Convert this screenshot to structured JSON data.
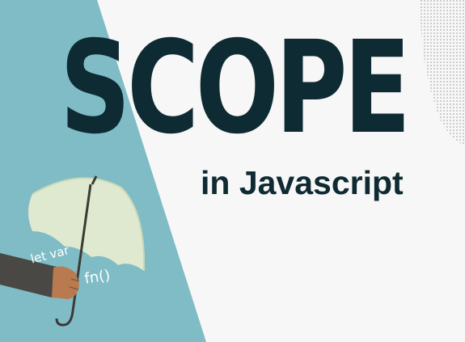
{
  "title": "SCOPE",
  "subtitle": "in Javascript",
  "illustration": {
    "label_keywords": "let var",
    "label_function": "fn()"
  },
  "colors": {
    "teal": "#7fbcc6",
    "text_dark": "#0e2a32",
    "umbrella": "#dfe9cf",
    "sleeve": "#4a4844"
  }
}
